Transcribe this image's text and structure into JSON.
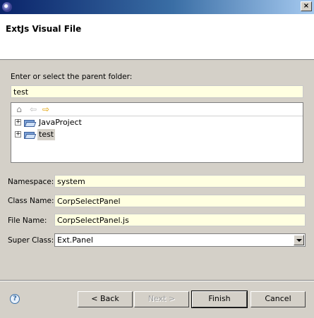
{
  "banner": {
    "title": "ExtJs Visual File"
  },
  "folder": {
    "prompt": "Enter or select the parent folder:",
    "value": "test",
    "tree": [
      {
        "label": "JavaProject",
        "selected": false
      },
      {
        "label": "test",
        "selected": true
      }
    ]
  },
  "form": {
    "namespace_label": "Namespace:",
    "namespace_value": "system",
    "class_label": "Class Name:",
    "class_value": "CorpSelectPanel",
    "file_label": "File Name:",
    "file_value": "CorpSelectPanel.js",
    "super_label": "Super Class:",
    "super_value": "Ext.Panel"
  },
  "buttons": {
    "help": "?",
    "back": "< Back",
    "next": "Next >",
    "finish": "Finish",
    "cancel": "Cancel"
  },
  "colors": {
    "field_bg": "#ffffe1",
    "dialog_bg": "#d4d0c8",
    "title_blue": "#0a246a"
  },
  "icons": [
    "eclipse-icon",
    "home-icon",
    "back-arrow-icon",
    "forward-arrow-icon",
    "folder-icon",
    "help-icon"
  ]
}
